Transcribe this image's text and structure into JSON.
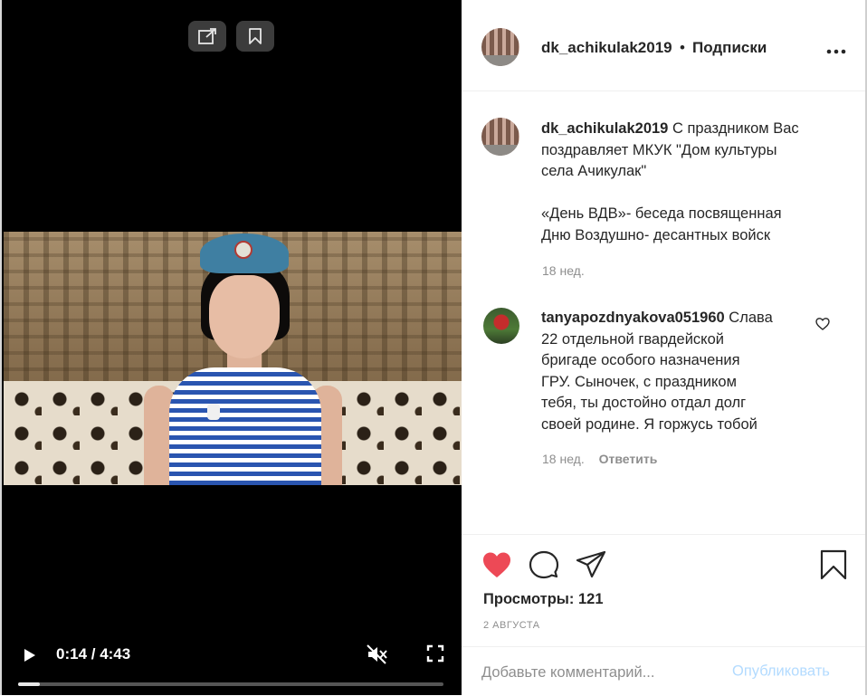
{
  "video": {
    "time": "0:14 / 4:43",
    "progress": 0.05,
    "buttons": {
      "share_icon": "external-share-icon",
      "bookmark_icon": "bookmark-icon",
      "play_icon": "play-icon",
      "mute_icon": "muted-speaker-icon",
      "fullscreen_icon": "fullscreen-icon"
    }
  },
  "header": {
    "username": "dk_achikulak2019",
    "separator": "•",
    "follow_label": "Подписки",
    "more_icon": "more-dots-icon"
  },
  "caption": {
    "username": "dk_achikulak2019",
    "text_line1": " С праздником Вас",
    "text_line2": "поздравляет МКУК \"Дом культуры",
    "text_line3": "села Ачикулак\"",
    "text_line4": "«День ВДВ»- беседа посвященная",
    "text_line5": "Дню Воздушно- десантных войск",
    "time": "18 нед."
  },
  "comment": {
    "username": "tanyapozdnyakova051960",
    "text_line1": " Слава",
    "text_line2": "22 отдельной гвардейской",
    "text_line3": "бригаде особого назначения",
    "text_line4": "ГРУ. Сыночек, с праздником",
    "text_line5": "тебя, ты достойно отдал долг",
    "text_line6": "своей родине. Я горжусь тобой",
    "time": "18 нед.",
    "reply_label": "Ответить"
  },
  "actions": {
    "like_icon": "heart-filled-icon",
    "comment_icon": "comment-bubble-icon",
    "share_icon": "paper-plane-icon",
    "save_icon": "bookmark-icon",
    "like_color": "#ed4956",
    "views_label": "Просмотры: 121",
    "date": "2 АВГУСТА"
  },
  "add_comment": {
    "placeholder": "Добавьте комментарий...",
    "publish_label": "Опубликовать",
    "publish_color": "#b3dbff"
  }
}
